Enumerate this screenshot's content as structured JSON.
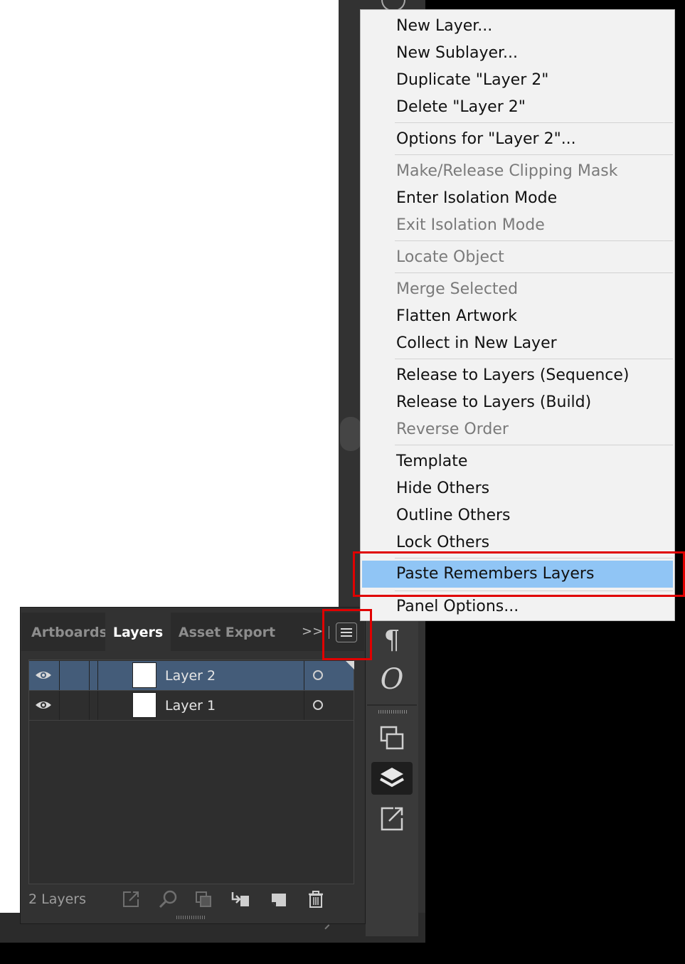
{
  "context_menu": {
    "items": [
      {
        "label": "New Layer...",
        "enabled": true
      },
      {
        "label": "New Sublayer...",
        "enabled": true
      },
      {
        "label": "Duplicate \"Layer 2\"",
        "enabled": true
      },
      {
        "label": "Delete \"Layer 2\"",
        "enabled": true
      },
      {
        "label": "Options for \"Layer 2\"...",
        "enabled": true
      },
      {
        "label": "Make/Release Clipping Mask",
        "enabled": false
      },
      {
        "label": "Enter Isolation Mode",
        "enabled": true
      },
      {
        "label": "Exit Isolation Mode",
        "enabled": false
      },
      {
        "label": "Locate Object",
        "enabled": false
      },
      {
        "label": "Merge Selected",
        "enabled": false
      },
      {
        "label": "Flatten Artwork",
        "enabled": true
      },
      {
        "label": "Collect in New Layer",
        "enabled": true
      },
      {
        "label": "Release to Layers (Sequence)",
        "enabled": true
      },
      {
        "label": "Release to Layers (Build)",
        "enabled": true
      },
      {
        "label": "Reverse Order",
        "enabled": false
      },
      {
        "label": "Template",
        "enabled": true
      },
      {
        "label": "Hide Others",
        "enabled": true
      },
      {
        "label": "Outline Others",
        "enabled": true
      },
      {
        "label": "Lock Others",
        "enabled": true
      },
      {
        "label": "Paste Remembers Layers",
        "enabled": true,
        "highlighted": true
      },
      {
        "label": "Panel Options...",
        "enabled": true
      }
    ]
  },
  "panel": {
    "tabs": [
      {
        "label": "Artboards",
        "active": false
      },
      {
        "label": "Layers",
        "active": true
      },
      {
        "label": "Asset Export",
        "active": false
      }
    ],
    "overflow_icon": ">>",
    "menu_icon": "hamburger-icon",
    "layers": [
      {
        "name": "Layer 2",
        "visible": true,
        "selected": true
      },
      {
        "name": "Layer 1",
        "visible": true,
        "selected": false
      }
    ],
    "footer": {
      "count_label": "2 Layers",
      "icons": [
        "export-icon",
        "locate-object-icon",
        "clipping-mask-icon",
        "new-sublayer-icon",
        "new-layer-icon",
        "trash-icon"
      ]
    }
  },
  "tool_strip": {
    "paragraph_glyph": "¶",
    "opentype_glyph": "O",
    "icons": [
      "paragraph-icon",
      "opentype-icon",
      "artboards-icon",
      "layers-icon",
      "asset-export-icon"
    ]
  },
  "colors": {
    "menu_highlight": "#90c5f5",
    "selected_row": "#445c79",
    "annotation_red": "#e00000"
  }
}
